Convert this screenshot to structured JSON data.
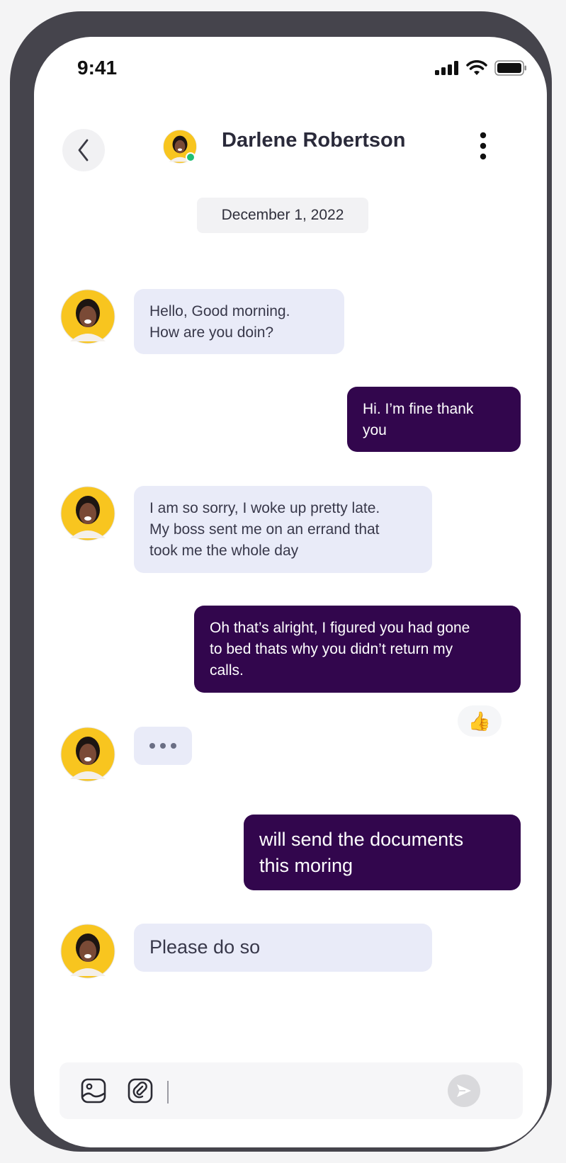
{
  "status_bar": {
    "time": "9:41"
  },
  "header": {
    "contact_name": "Darlene Robertson"
  },
  "date_label": "December 1, 2022",
  "messages": [
    {
      "side": "incoming",
      "text": "Hello, Good morning.\nHow are you doin?"
    },
    {
      "side": "outgoing",
      "text": "Hi. I’m fine thank\nyou"
    },
    {
      "side": "incoming",
      "text": "I am so sorry, I woke up pretty late.\nMy boss sent me on an errand that\ntook me the whole day"
    },
    {
      "side": "outgoing",
      "text": "Oh that’s alright, I figured you had gone\nto bed thats why you didn’t return my\ncalls.",
      "reaction": "👍"
    },
    {
      "side": "incoming",
      "typing": true
    },
    {
      "side": "outgoing",
      "text": "will send the documents\nthis moring"
    },
    {
      "side": "incoming",
      "text": "Please do so"
    }
  ],
  "composer": {
    "value": "",
    "placeholder": ""
  },
  "colors": {
    "accent": "#32064d",
    "incoming_bubble": "#e9ebf8",
    "online": "#1fbf75",
    "avatar_bg": "#f8c51f"
  },
  "icons": {
    "back": "chevron-left-icon",
    "more": "more-vertical-icon",
    "gallery": "image-icon",
    "attach": "attach-icon",
    "send": "send-icon",
    "reaction": "thumbs-up-icon"
  }
}
